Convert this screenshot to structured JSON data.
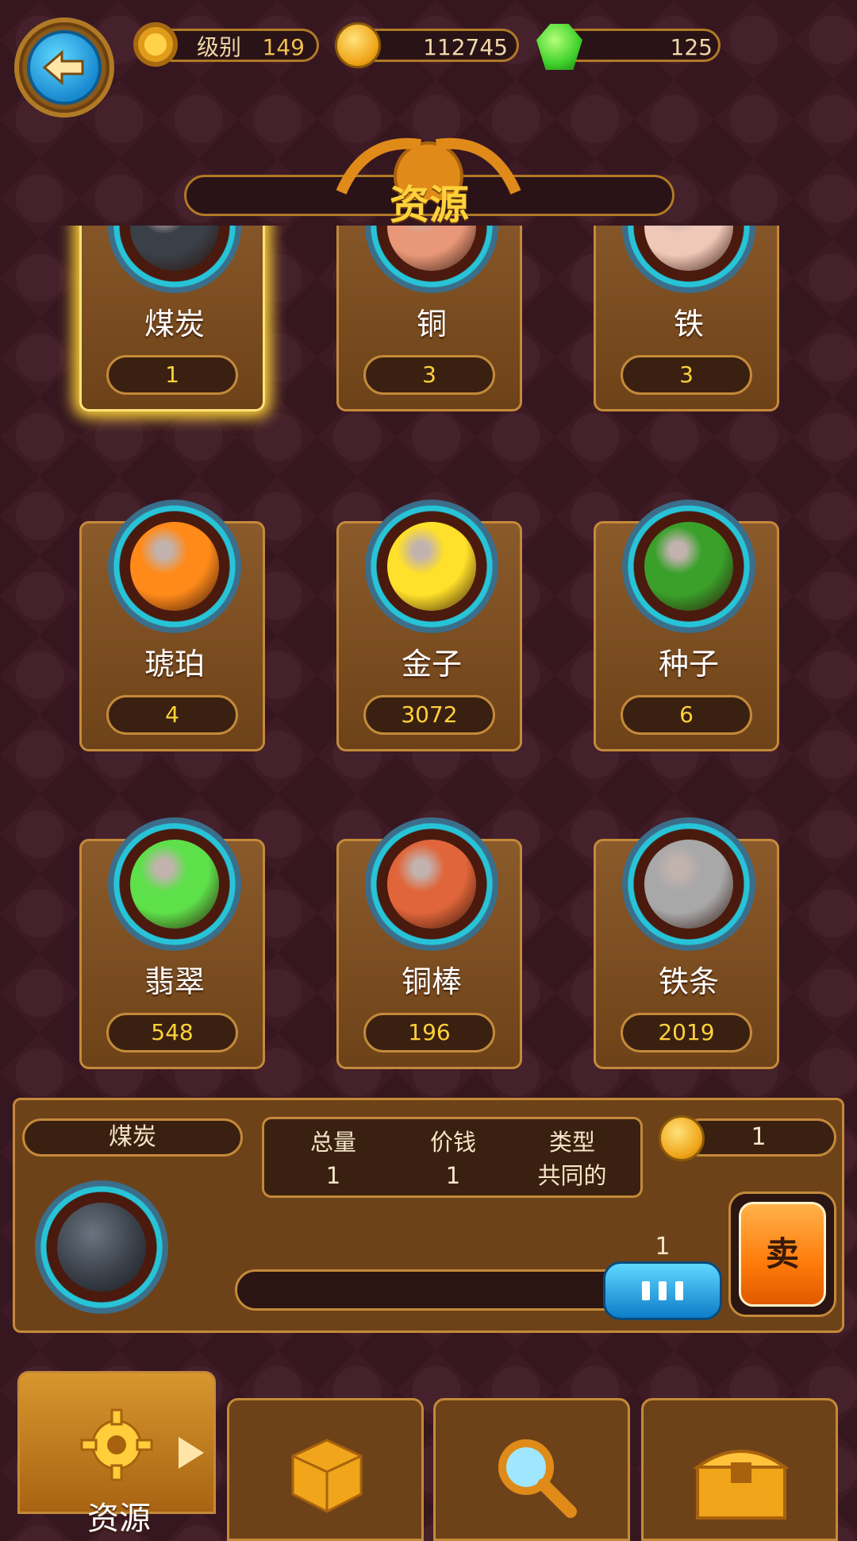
{
  "header": {
    "level_label": "级别",
    "level_value": "149",
    "coins": "112745",
    "gems": "125",
    "back_icon": "arrow-left-icon"
  },
  "title": "资源",
  "resources": [
    {
      "name": "煤炭",
      "count": "1",
      "color": "#3a4048",
      "selected": true
    },
    {
      "name": "铜",
      "count": "3",
      "color": "#e89878",
      "selected": false
    },
    {
      "name": "铁",
      "count": "3",
      "color": "#f0c8b8",
      "selected": false
    },
    {
      "name": "琥珀",
      "count": "4",
      "color": "#ff8a1a",
      "selected": false
    },
    {
      "name": "金子",
      "count": "3072",
      "color": "#ffe02a",
      "selected": false
    },
    {
      "name": "种子",
      "count": "6",
      "color": "#3aa02a",
      "selected": false
    },
    {
      "name": "翡翠",
      "count": "548",
      "color": "#5ee04a",
      "selected": false
    },
    {
      "name": "铜棒",
      "count": "196",
      "color": "#e0653a",
      "selected": false
    },
    {
      "name": "铁条",
      "count": "2019",
      "color": "#a8a8a8",
      "selected": false
    }
  ],
  "detail": {
    "name": "煤炭",
    "total_label": "总量",
    "total_value": "1",
    "price_label": "价钱",
    "price_value": "1",
    "type_label": "类型",
    "type_value": "共同的",
    "unit_price": "1",
    "quantity": "1",
    "quantity_fraction": 1.0,
    "sell_label": "卖"
  },
  "tabs": [
    {
      "label": "资源",
      "icon": "gear-icon",
      "active": true
    },
    {
      "label": "",
      "icon": "dice-icon",
      "active": false
    },
    {
      "label": "",
      "icon": "magnifier-icon",
      "active": false
    },
    {
      "label": "",
      "icon": "treasure-chest-icon",
      "active": false
    }
  ]
}
